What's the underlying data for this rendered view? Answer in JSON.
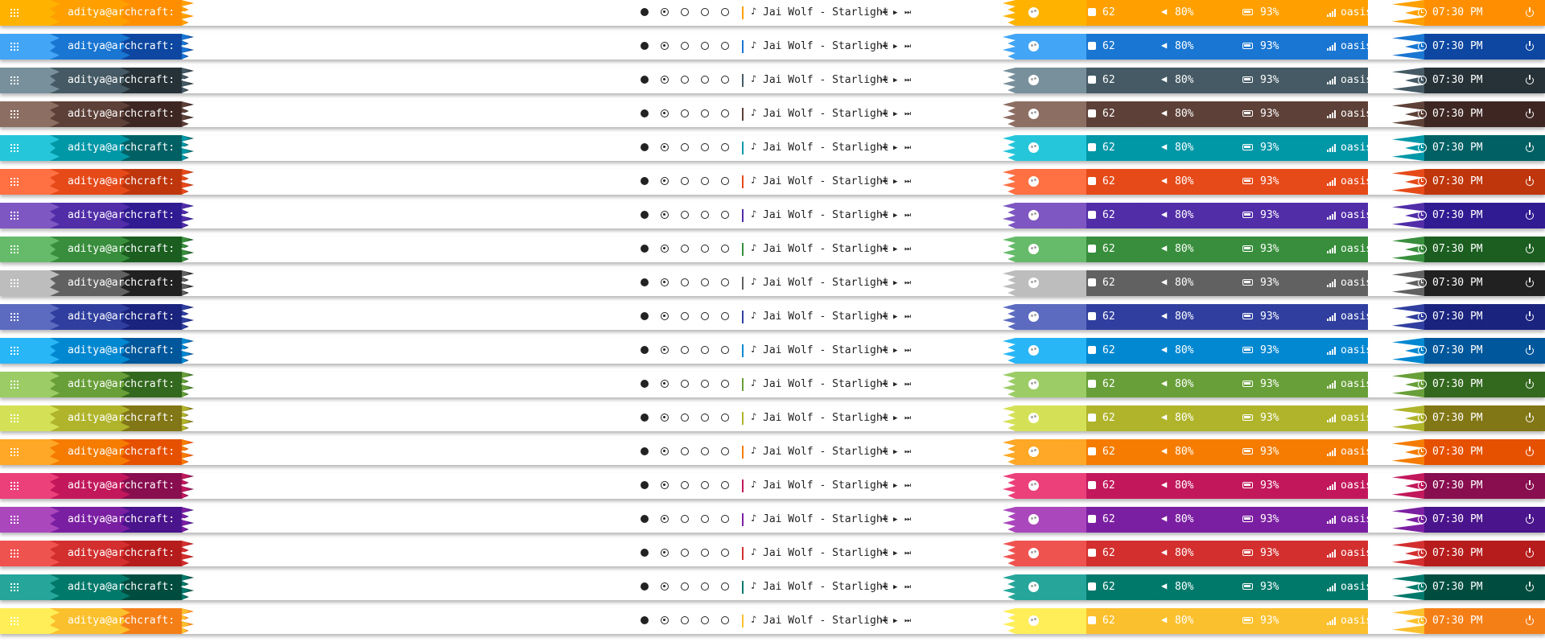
{
  "statusbar": {
    "user_host": "aditya@archcraft: ~",
    "track": "Jai Wolf - Starlight",
    "updates": "62",
    "volume": "80%",
    "battery": "93%",
    "network": "oasis",
    "time": "07:30 PM"
  },
  "icons": {
    "apps": "grid-icon",
    "music": "music-note-icon",
    "prev": "skip-previous-icon",
    "play": "play-icon",
    "next": "skip-next-icon",
    "palette": "palette-icon",
    "updates": "package-icon",
    "volume": "volume-icon",
    "battery": "battery-icon",
    "network": "signal-icon",
    "clock": "clock-icon",
    "power": "power-icon"
  },
  "workspaces": [
    "filled",
    "ring",
    "empty",
    "empty",
    "empty"
  ],
  "themes": [
    {
      "name": "amber",
      "dark": "#ff8f00",
      "mid": "#ffa000",
      "light": "#ffb300"
    },
    {
      "name": "blue",
      "dark": "#0d47a1",
      "mid": "#1976d2",
      "light": "#42a5f5"
    },
    {
      "name": "blue-gray",
      "dark": "#263238",
      "mid": "#455a64",
      "light": "#78909c"
    },
    {
      "name": "brown",
      "dark": "#3e2723",
      "mid": "#5d4037",
      "light": "#8d6e63"
    },
    {
      "name": "cyan",
      "dark": "#006064",
      "mid": "#0097a7",
      "light": "#26c6da"
    },
    {
      "name": "deep-orange",
      "dark": "#bf360c",
      "mid": "#e64a19",
      "light": "#ff7043"
    },
    {
      "name": "deep-purple",
      "dark": "#311b92",
      "mid": "#512da8",
      "light": "#7e57c2"
    },
    {
      "name": "green",
      "dark": "#1b5e20",
      "mid": "#388e3c",
      "light": "#66bb6a"
    },
    {
      "name": "gray",
      "dark": "#212121",
      "mid": "#616161",
      "light": "#bdbdbd"
    },
    {
      "name": "indigo",
      "dark": "#1a237e",
      "mid": "#303f9f",
      "light": "#5c6bc0"
    },
    {
      "name": "light-blue",
      "dark": "#01579b",
      "mid": "#0288d1",
      "light": "#29b6f6"
    },
    {
      "name": "light-green",
      "dark": "#33691e",
      "mid": "#689f38",
      "light": "#9ccc65"
    },
    {
      "name": "lime",
      "dark": "#827717",
      "mid": "#afb42b",
      "light": "#d4e157"
    },
    {
      "name": "orange",
      "dark": "#e65100",
      "mid": "#f57c00",
      "light": "#ffa726"
    },
    {
      "name": "pink",
      "dark": "#880e4f",
      "mid": "#c2185b",
      "light": "#ec407a"
    },
    {
      "name": "purple",
      "dark": "#4a148c",
      "mid": "#7b1fa2",
      "light": "#ab47bc"
    },
    {
      "name": "red",
      "dark": "#b71c1c",
      "mid": "#d32f2f",
      "light": "#ef5350"
    },
    {
      "name": "teal",
      "dark": "#004d40",
      "mid": "#00796b",
      "light": "#26a69a"
    },
    {
      "name": "yellow",
      "dark": "#f57f17",
      "mid": "#fbc02d",
      "light": "#ffee58"
    }
  ]
}
